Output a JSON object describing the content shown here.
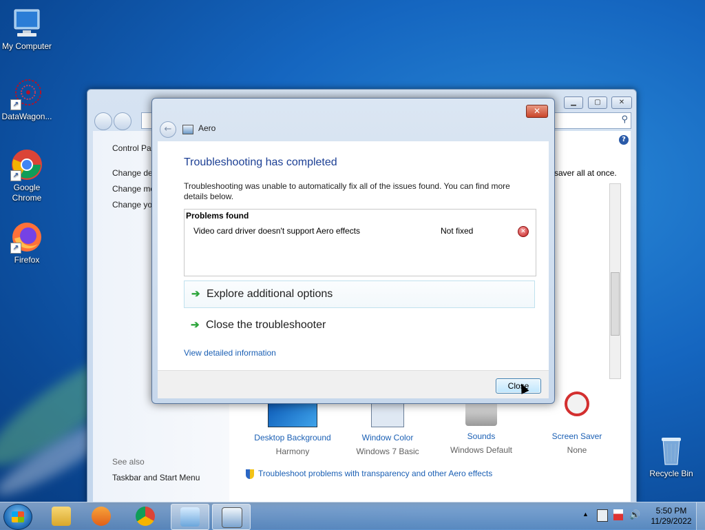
{
  "desktop": {
    "icons": [
      {
        "label": "My Computer"
      },
      {
        "label": "DataWagon..."
      },
      {
        "label": "Google Chrome"
      },
      {
        "label": "Firefox"
      },
      {
        "label": "Recycle Bin"
      }
    ]
  },
  "control_panel": {
    "breadcrumb": "Control Panel",
    "left_links": [
      "Change de",
      "Change mo",
      "Change yo"
    ],
    "right_text": "saver all at once.",
    "see_also_heading": "See also",
    "see_also_link": "Taskbar and Start Menu",
    "items": [
      {
        "label": "Desktop Background",
        "value": "Harmony"
      },
      {
        "label": "Window Color",
        "value": "Windows 7 Basic"
      },
      {
        "label": "Sounds",
        "value": "Windows Default"
      },
      {
        "label": "Screen Saver",
        "value": "None"
      }
    ],
    "troubleshoot_link": "Troubleshoot problems with transparency and other Aero effects",
    "help_glyph": "?",
    "search_glyph": "⚲"
  },
  "dialog": {
    "title": "Aero",
    "close_glyph": "✕",
    "heading": "Troubleshooting has completed",
    "description": "Troubleshooting was unable to automatically fix all of the issues found. You can find more details below.",
    "problems_header": "Problems found",
    "problem": {
      "name": "Video card driver doesn't support Aero effects",
      "status": "Not fixed"
    },
    "options": [
      {
        "label": "Explore additional options"
      },
      {
        "label": "Close the troubleshooter"
      }
    ],
    "view_details_link": "View detailed information",
    "close_button": "Close"
  },
  "taskbar": {
    "time": "5:50 PM",
    "date": "11/29/2022",
    "tray_chevron": "▲",
    "volume_glyph": "🔊"
  },
  "colors": {
    "accent_link": "#1a5fb4",
    "heading_blue": "#1c3f94",
    "option_arrow": "#2da53b",
    "error_red": "#c21b1b"
  }
}
